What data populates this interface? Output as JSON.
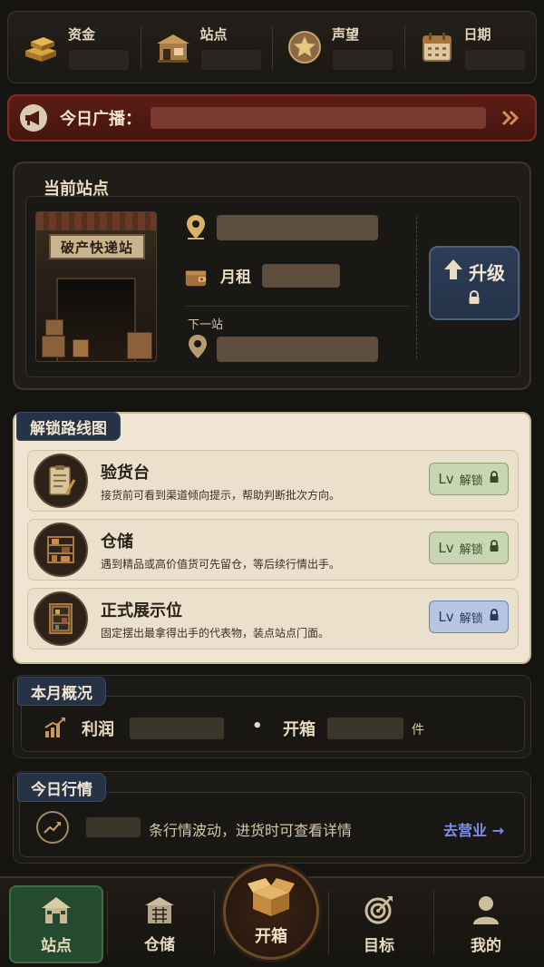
{
  "stats": [
    {
      "label": "资金",
      "icon": "gold-bars-icon"
    },
    {
      "label": "站点",
      "icon": "shop-icon"
    },
    {
      "label": "声望",
      "icon": "star-badge-icon"
    },
    {
      "label": "日期",
      "icon": "calendar-icon"
    }
  ],
  "broadcast": {
    "label": "今日广播："
  },
  "station": {
    "title": "当前站点",
    "shop_sign": "破产快递站",
    "rent_label": "月租",
    "next_label": "下一站",
    "upgrade_label": "升级"
  },
  "roadmap": {
    "title": "解锁路线图",
    "items": [
      {
        "title": "验货台",
        "desc": "接货前可看到渠道倾向提示，帮助判断批次方向。",
        "lv": "Lv",
        "unlock": "解锁",
        "style": "green"
      },
      {
        "title": "仓储",
        "desc": "遇到精品或高价值货可先留仓，等后续行情出手。",
        "lv": "Lv",
        "unlock": "解锁",
        "style": "green"
      },
      {
        "title": "正式展示位",
        "desc": "固定摆出最拿得出手的代表物，装点站点门面。",
        "lv": "Lv",
        "unlock": "解锁",
        "style": "blue"
      }
    ]
  },
  "month": {
    "title": "本月概况",
    "profit_label": "利润",
    "sep": "•",
    "open_label": "开箱",
    "unit": "件"
  },
  "market": {
    "title": "今日行情",
    "text": "条行情波动，进货时可查看详情",
    "link": "去营业 →"
  },
  "nav": {
    "items": [
      "站点",
      "仓储",
      "开箱",
      "目标",
      "我的"
    ]
  },
  "colors": {
    "accent_green": "#244a30",
    "accent_red": "#5a1d16",
    "link_blue": "#7c8fe8",
    "upgrade_blue": "#2d3d55"
  }
}
